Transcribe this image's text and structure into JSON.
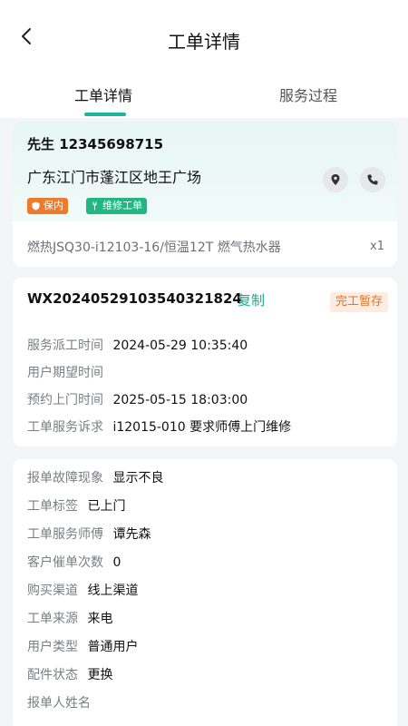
{
  "header": {
    "title": "工单详情",
    "back_icon": "chevron-left-icon"
  },
  "tabs": [
    {
      "label": "工单详情",
      "active": true
    },
    {
      "label": "服务过程",
      "active": false
    }
  ],
  "customer": {
    "name_phone": "先生  12345698715",
    "address": "广东江门市蓬江区地王广场",
    "location_icon": "location-pin-icon",
    "phone_icon": "phone-icon",
    "tags": [
      {
        "label": "保内",
        "color": "#f07a2b",
        "icon": "shield-icon"
      },
      {
        "label": "维修工单",
        "color": "#20b784",
        "icon": "wrench-icon"
      }
    ]
  },
  "product": {
    "name": "燃热JSQ30-i12103-16/恒温12T  燃气热水器",
    "quantity": "x1"
  },
  "order": {
    "number": "WX20240529103540321824",
    "copy_label": "复制",
    "status": "完工暂存",
    "status_color": "#e4742a",
    "fields": [
      {
        "label": "服务派工时间",
        "value": "2024-05-29 10:35:40"
      },
      {
        "label": "用户期望时间",
        "value": ""
      },
      {
        "label": "预约上门时间",
        "value": "2025-05-15   18:03:00"
      },
      {
        "label": "工单服务诉求",
        "value": "i12015-010  要求师傅上门维修"
      }
    ]
  },
  "details": [
    {
      "label": "报单故障现象",
      "value": "显示不良"
    },
    {
      "label": "工单标签",
      "value": "已上门"
    },
    {
      "label": "工单服务师傅",
      "value": "谭先森"
    },
    {
      "label": "客户催单次数",
      "value": "0"
    },
    {
      "label": "购买渠道",
      "value": "线上渠道"
    },
    {
      "label": "工单来源",
      "value": "来电"
    },
    {
      "label": "用户类型",
      "value": "普通用户"
    },
    {
      "label": "配件状态",
      "value": "更换"
    },
    {
      "label": "报单人姓名",
      "value": ""
    }
  ],
  "theme": {
    "accent": "#1bb59a"
  }
}
